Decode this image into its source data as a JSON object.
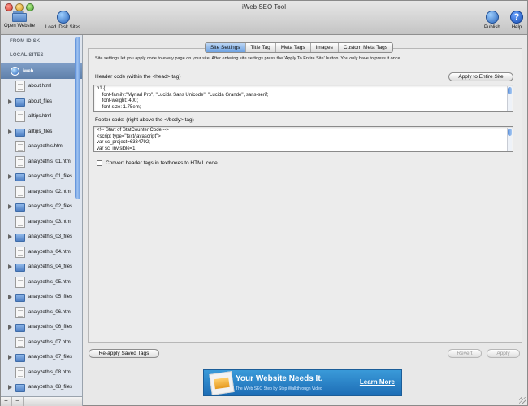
{
  "window": {
    "title": "iWeb SEO Tool"
  },
  "toolbar": {
    "open_website": "Open Website",
    "load_idisk": "Load iDisk Sites",
    "publish": "Publish",
    "help": "Help",
    "help_glyph": "?"
  },
  "sidebar": {
    "from_idisk": "FROM IDISK",
    "local_sites": "LOCAL SITES",
    "selected_site": "iweb",
    "items": [
      {
        "name": "about.html",
        "type": "file"
      },
      {
        "name": "about_files",
        "type": "folder"
      },
      {
        "name": "alltips.html",
        "type": "file"
      },
      {
        "name": "alltips_files",
        "type": "folder"
      },
      {
        "name": "analyzethis.html",
        "type": "file"
      },
      {
        "name": "analyzethis_01.html",
        "type": "file"
      },
      {
        "name": "analyzethis_01_files",
        "type": "folder"
      },
      {
        "name": "analyzethis_02.html",
        "type": "file"
      },
      {
        "name": "analyzethis_02_files",
        "type": "folder"
      },
      {
        "name": "analyzethis_03.html",
        "type": "file"
      },
      {
        "name": "analyzethis_03_files",
        "type": "folder"
      },
      {
        "name": "analyzethis_04.html",
        "type": "file"
      },
      {
        "name": "analyzethis_04_files",
        "type": "folder"
      },
      {
        "name": "analyzethis_05.html",
        "type": "file"
      },
      {
        "name": "analyzethis_05_files",
        "type": "folder"
      },
      {
        "name": "analyzethis_06.html",
        "type": "file"
      },
      {
        "name": "analyzethis_06_files",
        "type": "folder"
      },
      {
        "name": "analyzethis_07.html",
        "type": "file"
      },
      {
        "name": "analyzethis_07_files",
        "type": "folder"
      },
      {
        "name": "analyzethis_08.html",
        "type": "file"
      },
      {
        "name": "analyzethis_08_files",
        "type": "folder"
      }
    ],
    "add_label": "+",
    "remove_label": "−"
  },
  "tabs": [
    "Site Settings",
    "Title Tag",
    "Meta Tags",
    "Images",
    "Custom Meta Tags"
  ],
  "active_tab": 0,
  "site_settings": {
    "description": "Site settings let you apply code to every page on your site. After entering site settings press the 'Apply To Entire Site' button. You only have to press it once.",
    "header_label": "Header code (within the <head> tag)",
    "apply_button": "Apply to Entire Site",
    "header_code": "h1 {\n    font-family:\"Myriad Pro\", \"Lucida Sans Unicode\", \"Lucida Grande\", sans-serif;\n    font-weight: 400;\n    font-size: 1.75em;",
    "footer_label": "Footer code: (right above the </body> tag)",
    "footer_code": "<!-- Start of StatCounter Code -->\n<script type=\"text/javascript\">\nvar sc_project=6334792;\nvar sc_invisible=1;",
    "convert_checkbox": "Convert header tags in textboxes to HTML code",
    "convert_checked": false
  },
  "bottom": {
    "reapply": "Re-apply Saved Tags",
    "revert": "Revert",
    "apply": "Apply"
  },
  "banner": {
    "headline": "Your Website Needs It.",
    "subline": "The iWeb SEO Step by Step Walkthrough Video",
    "cta": "Learn More"
  },
  "colors": {
    "accent": "#6ea3e3",
    "sidebar_bg": "#dfe5ee",
    "selection": "#5f80aa",
    "banner": "#1d6db5"
  }
}
